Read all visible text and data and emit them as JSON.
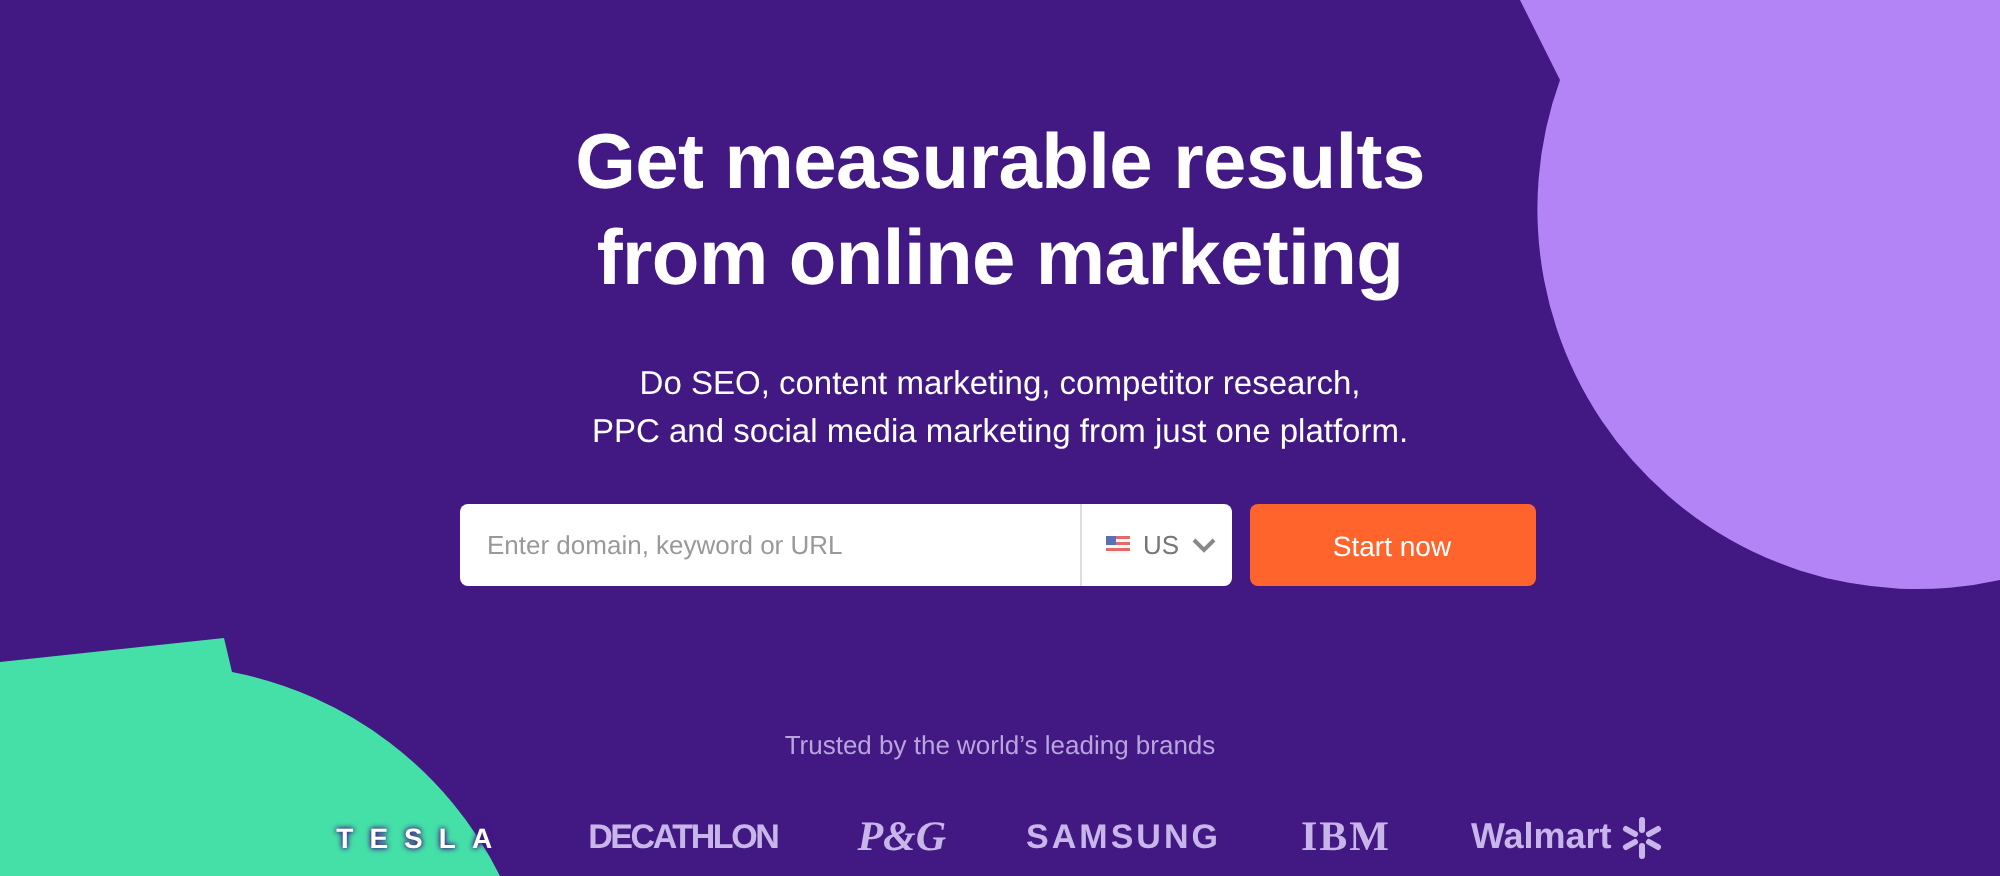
{
  "hero": {
    "title_lines": [
      "Get measurable results",
      "from online marketing"
    ],
    "subtitle_lines": [
      "Do SEO, content marketing, competitor research,",
      "PPC and social media marketing from just one platform."
    ]
  },
  "search": {
    "placeholder": "Enter domain, keyword or URL",
    "country": "US",
    "button": "Start now"
  },
  "brands": {
    "caption": "Trusted by the world’s leading brands",
    "logos": [
      {
        "kind": "tesla",
        "text": "TESLA"
      },
      {
        "kind": "decathlon",
        "text": "DECATHLON"
      },
      {
        "kind": "pg",
        "text": "P&G"
      },
      {
        "kind": "samsung",
        "text": "SAMSUNG"
      },
      {
        "kind": "ibm",
        "text": "IBM"
      },
      {
        "kind": "walmart",
        "text": "Walmart"
      }
    ]
  }
}
